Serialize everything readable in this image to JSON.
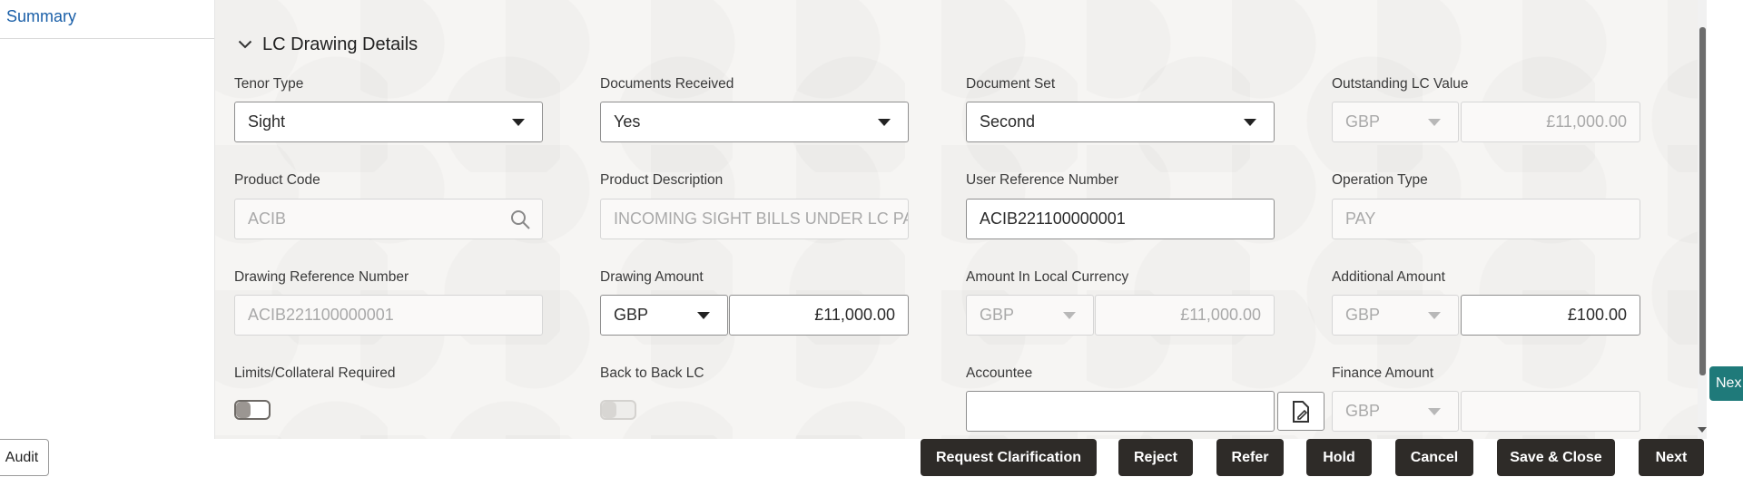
{
  "sidebar": {
    "summary_label": "Summary"
  },
  "section": {
    "title": "LC Drawing Details"
  },
  "fields": {
    "tenor_type": {
      "label": "Tenor Type",
      "value": "Sight"
    },
    "documents_received": {
      "label": "Documents Received",
      "value": "Yes"
    },
    "document_set": {
      "label": "Document Set",
      "value": "Second"
    },
    "outstanding_lc_value": {
      "label": "Outstanding LC Value",
      "currency": "GBP",
      "amount": "£11,000.00"
    },
    "product_code": {
      "label": "Product Code",
      "value": "ACIB"
    },
    "product_description": {
      "label": "Product Description",
      "value": "INCOMING SIGHT BILLS UNDER LC PAY"
    },
    "user_reference_number": {
      "label": "User Reference Number",
      "value": "ACIB221100000001"
    },
    "operation_type": {
      "label": "Operation Type",
      "value": "PAY"
    },
    "drawing_reference_number": {
      "label": "Drawing Reference Number",
      "value": "ACIB221100000001"
    },
    "drawing_amount": {
      "label": "Drawing Amount",
      "currency": "GBP",
      "amount": "£11,000.00"
    },
    "amount_in_local_currency": {
      "label": "Amount In Local Currency",
      "currency": "GBP",
      "amount": "£11,000.00"
    },
    "additional_amount": {
      "label": "Additional Amount",
      "currency": "GBP",
      "amount": "£100.00"
    },
    "limits_collateral_required": {
      "label": "Limits/Collateral Required",
      "on": false
    },
    "back_to_back_lc": {
      "label": "Back to Back LC",
      "on": false
    },
    "accountee": {
      "label": "Accountee",
      "value": ""
    },
    "finance_amount": {
      "label": "Finance Amount",
      "currency": "GBP",
      "amount": ""
    }
  },
  "side_next_label": "Nex",
  "footer": {
    "audit_label": "Audit",
    "buttons": {
      "request_clarification": "Request Clarification",
      "reject": "Reject",
      "refer": "Refer",
      "hold": "Hold",
      "cancel": "Cancel",
      "save_close": "Save & Close",
      "next": "Next"
    }
  },
  "icons": {
    "section_toggle": "chevron-down-icon",
    "dropdown": "caret-down-icon",
    "product_search": "search-icon",
    "accountee_lookup": "document-edit-icon"
  },
  "colors": {
    "footer_button_bg": "#2e2b28",
    "link_blue": "#1a5fa8",
    "next_stub_bg": "#1f7a7a"
  }
}
